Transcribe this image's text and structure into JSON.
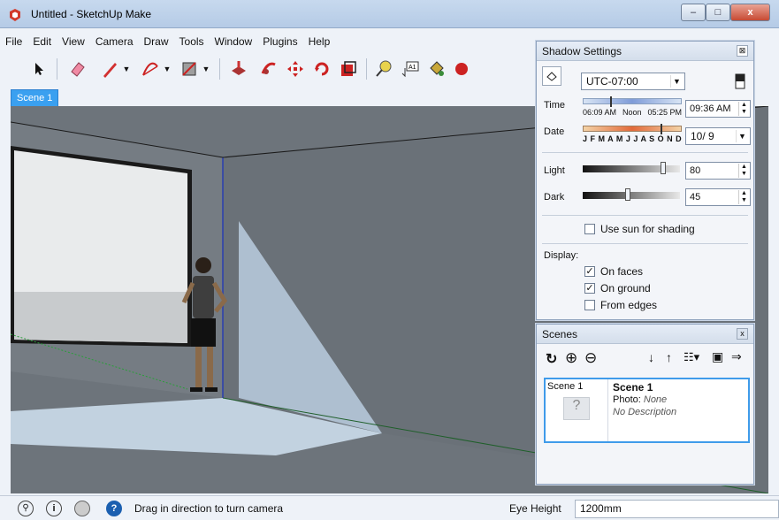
{
  "window": {
    "title": "Untitled - SketchUp Make",
    "minimize": "–",
    "maximize": "□",
    "close": "x"
  },
  "menu": [
    "File",
    "Edit",
    "View",
    "Camera",
    "Draw",
    "Tools",
    "Window",
    "Plugins",
    "Help"
  ],
  "scene_tab": "Scene 1",
  "status": {
    "text": "Drag in direction to turn camera",
    "eye_height_label": "Eye Height",
    "eye_height_value": "1200mm"
  },
  "shadow": {
    "title": "Shadow Settings",
    "timezone": "UTC-07:00",
    "time_label": "Time",
    "time_ticks": [
      "06:09 AM",
      "Noon",
      "05:25 PM"
    ],
    "time_value": "09:36 AM",
    "date_label": "Date",
    "months": "J F M A M J J A S O N D",
    "date_value": "10/ 9",
    "light_label": "Light",
    "light_value": "80",
    "dark_label": "Dark",
    "dark_value": "45",
    "use_sun": "Use sun for shading",
    "display_label": "Display:",
    "on_faces": "On faces",
    "on_ground": "On ground",
    "from_edges": "From edges"
  },
  "scenes": {
    "title": "Scenes",
    "thumb_label": "Scene 1",
    "name": "Scene 1",
    "photo_label": "Photo:",
    "photo_value": "None",
    "description": "No Description"
  },
  "colors": {
    "accent": "#3aa0f0",
    "viewport": "#6c737a"
  }
}
